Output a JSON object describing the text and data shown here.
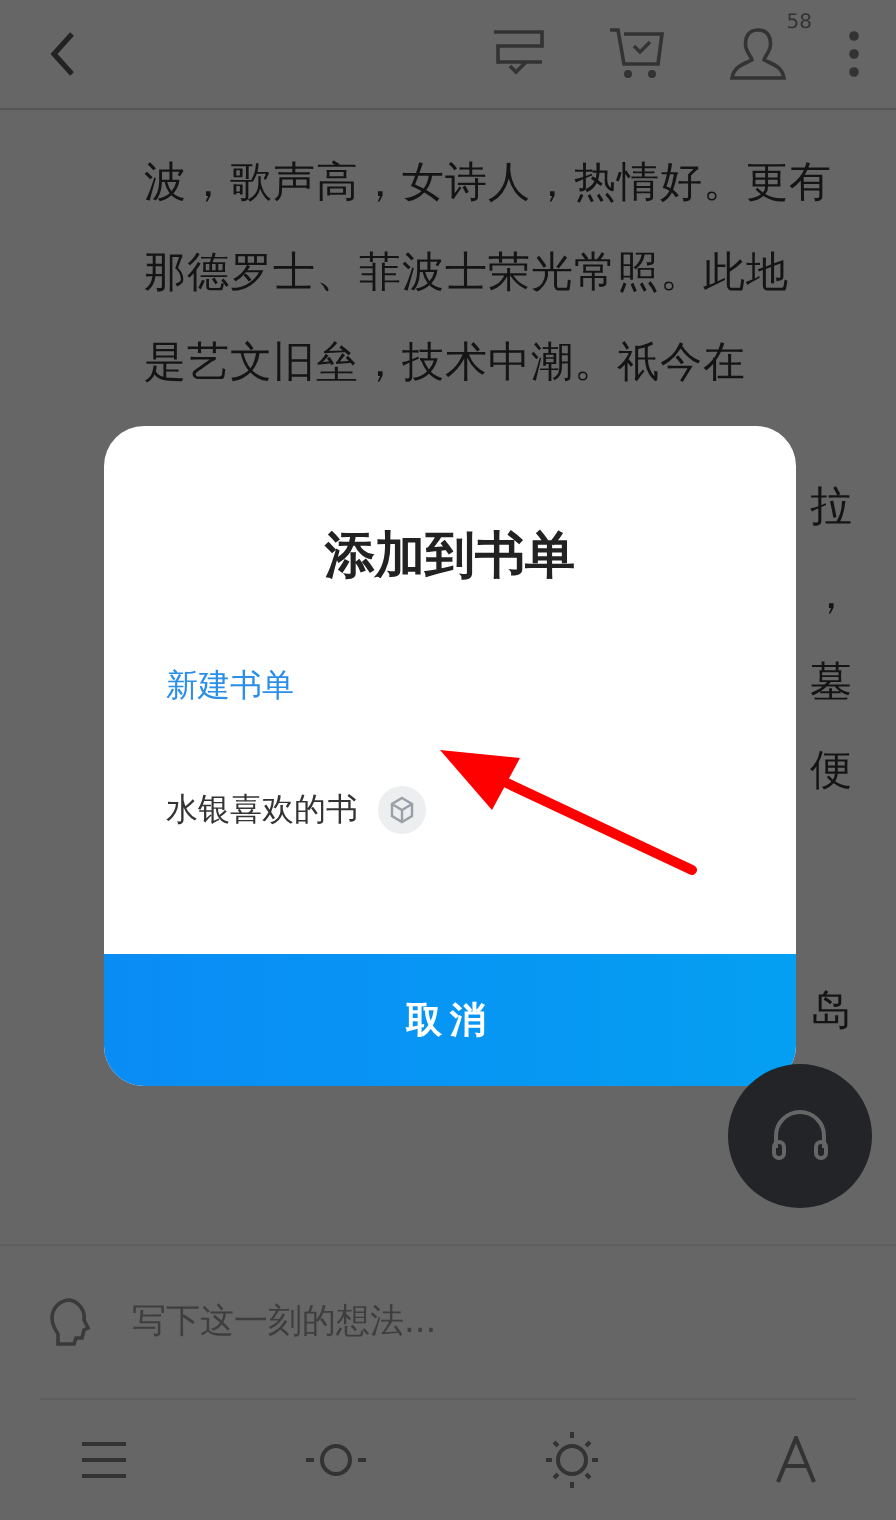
{
  "top_bar": {
    "badge": "58"
  },
  "reader": {
    "lines": [
      "波，歌声高，女诗人，热情好。更有",
      "那德罗士、菲波士荣光常照。此地",
      "是艺文旧垒，技术中潮。祇今在"
    ],
    "fragments": [
      "拉",
      "，",
      "墓",
      "便",
      "岛"
    ]
  },
  "dialog": {
    "title": "添加到书单",
    "items": [
      {
        "label": "新建书单",
        "kind": "action"
      },
      {
        "label": "水银喜欢的书",
        "kind": "list"
      }
    ],
    "cancel": "取消"
  },
  "comment": {
    "placeholder": "写下这一刻的想法..."
  }
}
